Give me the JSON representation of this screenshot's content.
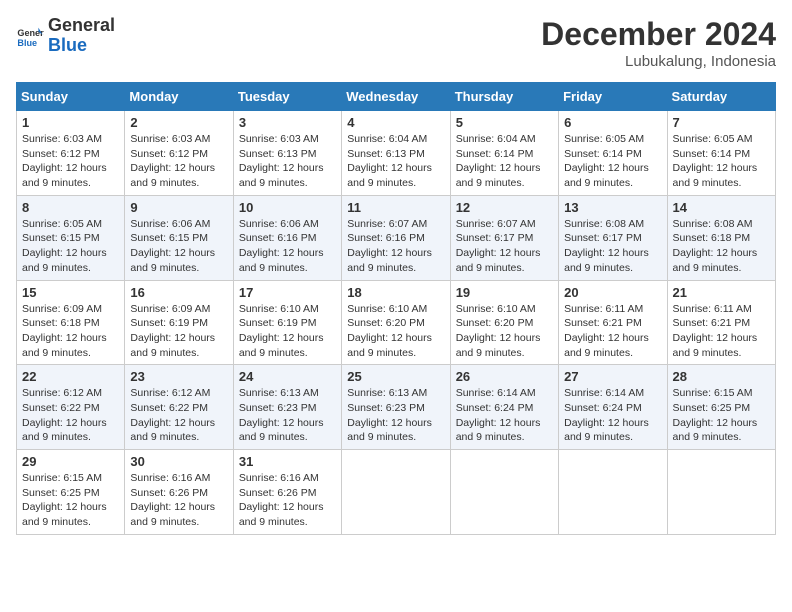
{
  "logo": {
    "general": "General",
    "blue": "Blue"
  },
  "header": {
    "month": "December 2024",
    "location": "Lubukalung, Indonesia"
  },
  "weekdays": [
    "Sunday",
    "Monday",
    "Tuesday",
    "Wednesday",
    "Thursday",
    "Friday",
    "Saturday"
  ],
  "weeks": [
    [
      {
        "day": 1,
        "sunrise": "6:03 AM",
        "sunset": "6:12 PM",
        "daylight": "12 hours and 9 minutes."
      },
      {
        "day": 2,
        "sunrise": "6:03 AM",
        "sunset": "6:12 PM",
        "daylight": "12 hours and 9 minutes."
      },
      {
        "day": 3,
        "sunrise": "6:03 AM",
        "sunset": "6:13 PM",
        "daylight": "12 hours and 9 minutes."
      },
      {
        "day": 4,
        "sunrise": "6:04 AM",
        "sunset": "6:13 PM",
        "daylight": "12 hours and 9 minutes."
      },
      {
        "day": 5,
        "sunrise": "6:04 AM",
        "sunset": "6:14 PM",
        "daylight": "12 hours and 9 minutes."
      },
      {
        "day": 6,
        "sunrise": "6:05 AM",
        "sunset": "6:14 PM",
        "daylight": "12 hours and 9 minutes."
      },
      {
        "day": 7,
        "sunrise": "6:05 AM",
        "sunset": "6:14 PM",
        "daylight": "12 hours and 9 minutes."
      }
    ],
    [
      {
        "day": 8,
        "sunrise": "6:05 AM",
        "sunset": "6:15 PM",
        "daylight": "12 hours and 9 minutes."
      },
      {
        "day": 9,
        "sunrise": "6:06 AM",
        "sunset": "6:15 PM",
        "daylight": "12 hours and 9 minutes."
      },
      {
        "day": 10,
        "sunrise": "6:06 AM",
        "sunset": "6:16 PM",
        "daylight": "12 hours and 9 minutes."
      },
      {
        "day": 11,
        "sunrise": "6:07 AM",
        "sunset": "6:16 PM",
        "daylight": "12 hours and 9 minutes."
      },
      {
        "day": 12,
        "sunrise": "6:07 AM",
        "sunset": "6:17 PM",
        "daylight": "12 hours and 9 minutes."
      },
      {
        "day": 13,
        "sunrise": "6:08 AM",
        "sunset": "6:17 PM",
        "daylight": "12 hours and 9 minutes."
      },
      {
        "day": 14,
        "sunrise": "6:08 AM",
        "sunset": "6:18 PM",
        "daylight": "12 hours and 9 minutes."
      }
    ],
    [
      {
        "day": 15,
        "sunrise": "6:09 AM",
        "sunset": "6:18 PM",
        "daylight": "12 hours and 9 minutes."
      },
      {
        "day": 16,
        "sunrise": "6:09 AM",
        "sunset": "6:19 PM",
        "daylight": "12 hours and 9 minutes."
      },
      {
        "day": 17,
        "sunrise": "6:10 AM",
        "sunset": "6:19 PM",
        "daylight": "12 hours and 9 minutes."
      },
      {
        "day": 18,
        "sunrise": "6:10 AM",
        "sunset": "6:20 PM",
        "daylight": "12 hours and 9 minutes."
      },
      {
        "day": 19,
        "sunrise": "6:10 AM",
        "sunset": "6:20 PM",
        "daylight": "12 hours and 9 minutes."
      },
      {
        "day": 20,
        "sunrise": "6:11 AM",
        "sunset": "6:21 PM",
        "daylight": "12 hours and 9 minutes."
      },
      {
        "day": 21,
        "sunrise": "6:11 AM",
        "sunset": "6:21 PM",
        "daylight": "12 hours and 9 minutes."
      }
    ],
    [
      {
        "day": 22,
        "sunrise": "6:12 AM",
        "sunset": "6:22 PM",
        "daylight": "12 hours and 9 minutes."
      },
      {
        "day": 23,
        "sunrise": "6:12 AM",
        "sunset": "6:22 PM",
        "daylight": "12 hours and 9 minutes."
      },
      {
        "day": 24,
        "sunrise": "6:13 AM",
        "sunset": "6:23 PM",
        "daylight": "12 hours and 9 minutes."
      },
      {
        "day": 25,
        "sunrise": "6:13 AM",
        "sunset": "6:23 PM",
        "daylight": "12 hours and 9 minutes."
      },
      {
        "day": 26,
        "sunrise": "6:14 AM",
        "sunset": "6:24 PM",
        "daylight": "12 hours and 9 minutes."
      },
      {
        "day": 27,
        "sunrise": "6:14 AM",
        "sunset": "6:24 PM",
        "daylight": "12 hours and 9 minutes."
      },
      {
        "day": 28,
        "sunrise": "6:15 AM",
        "sunset": "6:25 PM",
        "daylight": "12 hours and 9 minutes."
      }
    ],
    [
      {
        "day": 29,
        "sunrise": "6:15 AM",
        "sunset": "6:25 PM",
        "daylight": "12 hours and 9 minutes."
      },
      {
        "day": 30,
        "sunrise": "6:16 AM",
        "sunset": "6:26 PM",
        "daylight": "12 hours and 9 minutes."
      },
      {
        "day": 31,
        "sunrise": "6:16 AM",
        "sunset": "6:26 PM",
        "daylight": "12 hours and 9 minutes."
      },
      null,
      null,
      null,
      null
    ]
  ]
}
